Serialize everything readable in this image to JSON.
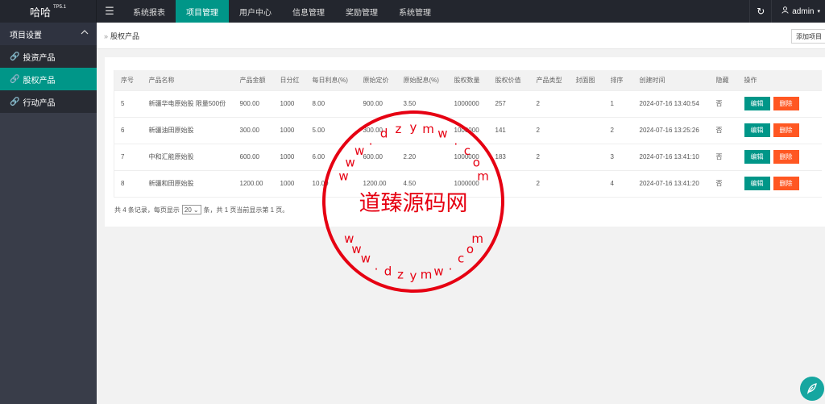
{
  "header": {
    "brand": "哈哈",
    "version": "TP5.1",
    "menu_icon": "menu-icon",
    "nav": [
      {
        "label": "系统报表"
      },
      {
        "label": "项目管理",
        "active": true
      },
      {
        "label": "用户中心"
      },
      {
        "label": "信息管理"
      },
      {
        "label": "奖励管理"
      },
      {
        "label": "系统管理"
      }
    ],
    "refresh_icon": "refresh-icon",
    "user_icon": "user-icon",
    "user": "admin",
    "user_caret_icon": "caret-down-icon"
  },
  "sidebar": {
    "group": "项目设置",
    "items": [
      {
        "label": "投资产品"
      },
      {
        "label": "股权产品",
        "active": true
      },
      {
        "label": "行动产品"
      }
    ]
  },
  "breadcrumb": {
    "sep": "»",
    "current": "股权产品"
  },
  "add_button": "添加项目",
  "table": {
    "headers": [
      "序号",
      "产品名称",
      "产品金额",
      "日分红",
      "每日利息(%)",
      "原始定价",
      "原始配息(%)",
      "股权数量",
      "股权价值",
      "产品类型",
      "封面图",
      "排序",
      "创建时间",
      "隐藏",
      "操作"
    ],
    "rows": [
      {
        "cells": [
          "5",
          "新疆华电原始股 限量500份",
          "900.00",
          "1000",
          "8.00",
          "900.00",
          "3.50",
          "1000000",
          "257",
          "2",
          "",
          "1",
          "2024-07-16 13:40:54",
          "否"
        ]
      },
      {
        "cells": [
          "6",
          "新疆油田原始股",
          "300.00",
          "1000",
          "5.00",
          "300.00",
          "",
          "1000000",
          "141",
          "2",
          "",
          "2",
          "2024-07-16 13:25:26",
          "否"
        ]
      },
      {
        "cells": [
          "7",
          "中和汇能原始股",
          "600.00",
          "1000",
          "6.00",
          "600.00",
          "2.20",
          "1000000",
          "183",
          "2",
          "",
          "3",
          "2024-07-16 13:41:10",
          "否"
        ]
      },
      {
        "cells": [
          "8",
          "新疆和田原始股",
          "1200.00",
          "1000",
          "10.00",
          "1200.00",
          "4.50",
          "1000000",
          "",
          "2",
          "",
          "4",
          "2024-07-16 13:41:20",
          "否"
        ]
      }
    ],
    "edit_label": "编辑",
    "delete_label": "删除"
  },
  "pager": {
    "before": "共 4 条记录，每页显示",
    "value": "20",
    "after": "条，共 1 页当前显示第 1 页。"
  },
  "watermark": {
    "center": "道臻源码网",
    "arc_text": "www.dzymw.com"
  },
  "colors": {
    "accent": "#009688",
    "danger": "#ff5722",
    "header": "#23262e",
    "stamp": "#e60012"
  }
}
